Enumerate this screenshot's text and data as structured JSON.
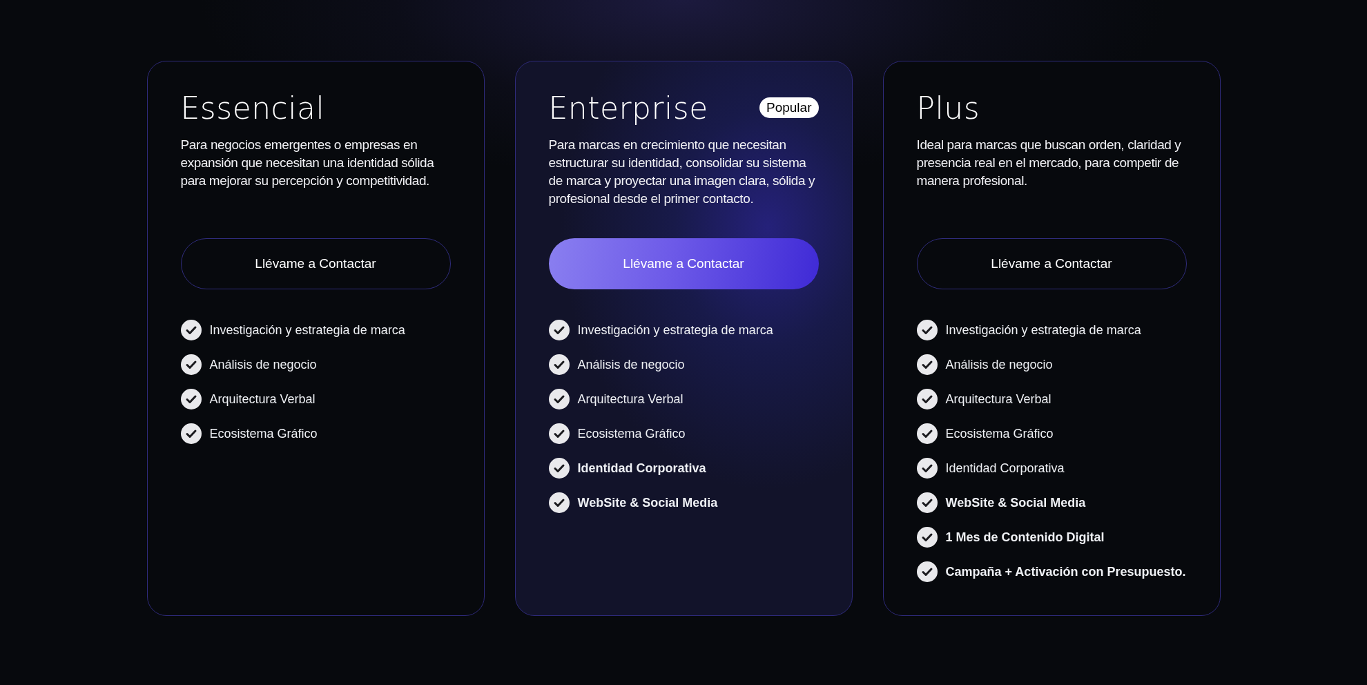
{
  "plans": [
    {
      "name": "Essencial",
      "featured": false,
      "description": "Para negocios emergentes o empresas en expansión que necesitan una identidad sólida para mejorar su percepción y competitividad.",
      "button": "Llévame a Contactar",
      "features": [
        {
          "text": "Investigación y estrategia de marca",
          "emphasized": false
        },
        {
          "text": "Análisis de negocio",
          "emphasized": false
        },
        {
          "text": "Arquitectura Verbal",
          "emphasized": false
        },
        {
          "text": "Ecosistema Gráfico",
          "emphasized": false
        }
      ]
    },
    {
      "name": "Enterprise",
      "featured": true,
      "badge": "Popular",
      "description": "Para marcas en crecimiento que necesitan estructurar su identidad, consolidar su sistema de marca y proyectar una imagen clara, sólida y profesional desde el primer contacto.",
      "button": "Llévame a Contactar",
      "features": [
        {
          "text": "Investigación y estrategia de marca",
          "emphasized": false
        },
        {
          "text": "Análisis de negocio",
          "emphasized": false
        },
        {
          "text": "Arquitectura Verbal",
          "emphasized": false
        },
        {
          "text": "Ecosistema Gráfico",
          "emphasized": false
        },
        {
          "text": "Identidad Corporativa",
          "emphasized": true
        },
        {
          "text": "WebSite & Social Media",
          "emphasized": true
        }
      ]
    },
    {
      "name": "Plus",
      "featured": false,
      "description": "Ideal para marcas que buscan orden, claridad y presencia real en el mercado, para competir de manera profesional.",
      "button": "Llévame a Contactar",
      "features": [
        {
          "text": "Investigación y estrategia de marca",
          "emphasized": false
        },
        {
          "text": "Análisis de negocio",
          "emphasized": false
        },
        {
          "text": "Arquitectura Verbal",
          "emphasized": false
        },
        {
          "text": "Ecosistema Gráfico",
          "emphasized": false
        },
        {
          "text": "Identidad Corporativa",
          "emphasized": false
        },
        {
          "text": "WebSite & Social Media",
          "emphasized": true
        },
        {
          "text": "1 Mes de Contenido Digital",
          "emphasized": true
        },
        {
          "text": "Campaña + Activación con Presupuesto.",
          "emphasized": true
        }
      ]
    }
  ]
}
